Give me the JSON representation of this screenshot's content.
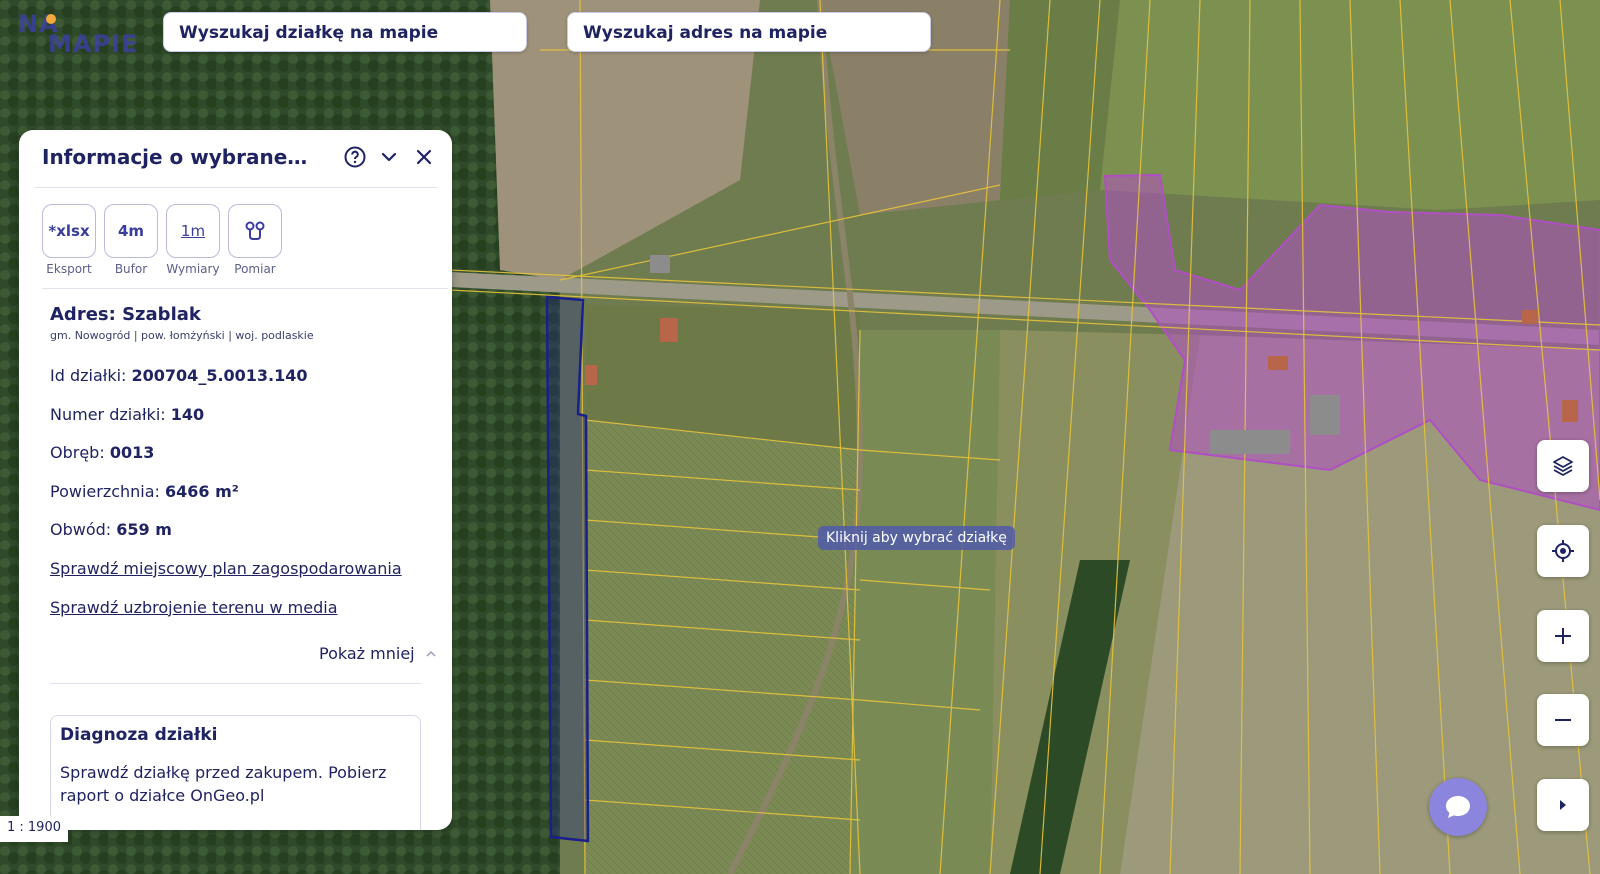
{
  "logo": {
    "line1": "NA",
    "line2": "MAPIE"
  },
  "search": {
    "parcel_placeholder": "Wyszukaj działkę na mapie",
    "address_placeholder": "Wyszukaj adres na mapie"
  },
  "panel": {
    "title": "Informacje o wybranej działce",
    "tools": [
      {
        "icon": "*xlsx",
        "label": "Eksport"
      },
      {
        "icon": "4m",
        "label": "Bufor"
      },
      {
        "icon": "1m",
        "label": "Wymiary"
      },
      {
        "icon": "route-icon",
        "label": "Pomiar"
      }
    ],
    "address": {
      "label": "Adres:",
      "value": "Szablak",
      "sub": "gm. Nowogród | pow. łomżyński | woj. podlaskie"
    },
    "fields": [
      {
        "label": "Id działki:",
        "value": "200704_5.0013.140"
      },
      {
        "label": "Numer działki:",
        "value": "140"
      },
      {
        "label": "Obręb:",
        "value": "0013"
      },
      {
        "label": "Powierzchnia:",
        "value": "6466 m²"
      },
      {
        "label": "Obwód:",
        "value": "659 m"
      }
    ],
    "links": [
      "Sprawdź miejscowy plan zagospodarowania",
      "Sprawdź uzbrojenie terenu w media"
    ],
    "toggle_label": "Pokaż mniej",
    "diagnosis": {
      "title": "Diagnoza działki",
      "text": "Sprawdź działkę przed zakupem. Pobierz raport o działce OnGeo.pl"
    }
  },
  "scale_label": "1 : 1900",
  "tooltip": "Kliknij aby wybrać działkę",
  "colors": {
    "brand": "#1f2362",
    "accent": "#3d3fb0",
    "selected_parcel": "#1a1f8a",
    "highlight_area": "#b04fc4",
    "parcel_lines": "#e8c43a",
    "chat": "#8b85de"
  }
}
